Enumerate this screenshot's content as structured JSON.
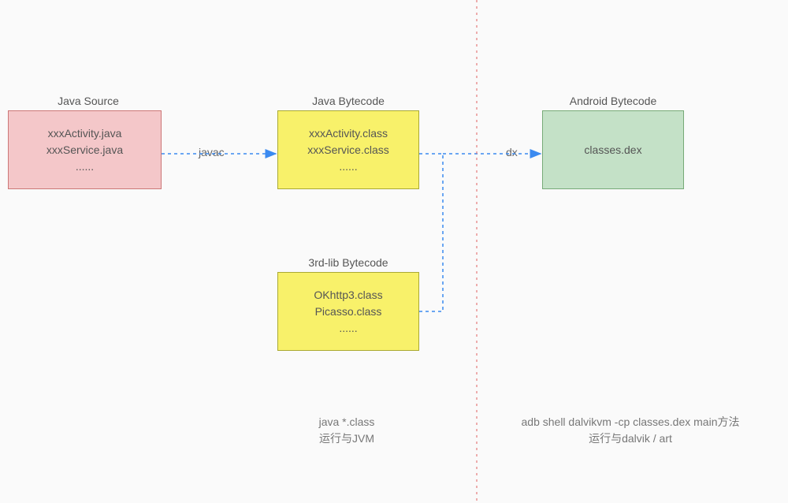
{
  "boxes": {
    "javaSource": {
      "title": "Java Source",
      "line1": "xxxActivity.java",
      "line2": "xxxService.java",
      "line3": "......"
    },
    "javaBytecode": {
      "title": "Java Bytecode",
      "line1": "xxxActivity.class",
      "line2": "xxxService.class",
      "line3": "......"
    },
    "thirdLib": {
      "title": "3rd-lib Bytecode",
      "line1": "OKhttp3.class",
      "line2": "Picasso.class",
      "line3": "......"
    },
    "androidBytecode": {
      "title": "Android Bytecode",
      "line1": "classes.dex"
    }
  },
  "arrows": {
    "javac": "javac",
    "dx": "dx"
  },
  "captions": {
    "left": {
      "line1": "java *.class",
      "line2": "运行与JVM"
    },
    "right": {
      "line1": "adb shell dalvikvm -cp  classes.dex  main方法",
      "line2": "运行与dalvik / art"
    }
  },
  "colors": {
    "arrow": "#3b8af0",
    "divider": "#e06060"
  }
}
